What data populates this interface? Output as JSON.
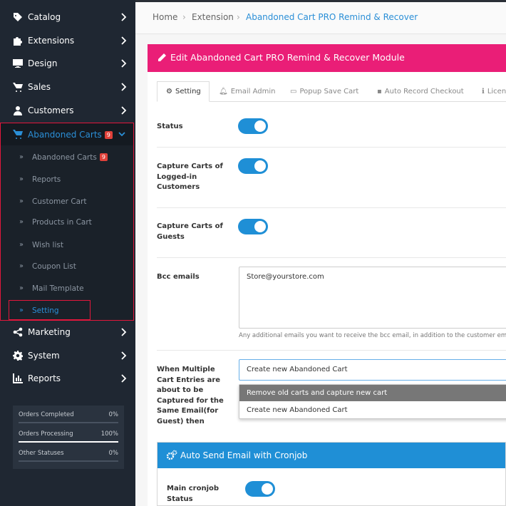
{
  "sidebar": {
    "items": [
      {
        "label": "Catalog",
        "icon": "tag-icon"
      },
      {
        "label": "Extensions",
        "icon": "puzzle-icon"
      },
      {
        "label": "Design",
        "icon": "monitor-icon"
      },
      {
        "label": "Sales",
        "icon": "cart-icon"
      },
      {
        "label": "Customers",
        "icon": "user-icon"
      }
    ],
    "abandoned": {
      "label": "Abandoned Carts",
      "badge": "9",
      "subitems": [
        {
          "label": "Abandoned Carts",
          "badge": "9"
        },
        {
          "label": "Reports"
        },
        {
          "label": "Customer Cart"
        },
        {
          "label": "Products in Cart"
        },
        {
          "label": "Wish list"
        },
        {
          "label": "Coupon List"
        },
        {
          "label": "Mail Template"
        },
        {
          "label": "Setting"
        }
      ]
    },
    "items_after": [
      {
        "label": "Marketing",
        "icon": "share-icon"
      },
      {
        "label": "System",
        "icon": "cog-icon"
      },
      {
        "label": "Reports",
        "icon": "bar-chart-icon"
      }
    ],
    "stats": [
      {
        "label": "Orders Completed",
        "value": "0%",
        "fraction": 0
      },
      {
        "label": "Orders Processing",
        "value": "100%",
        "fraction": 1
      },
      {
        "label": "Other Statuses",
        "value": "0%",
        "fraction": 0
      }
    ]
  },
  "breadcrumb": [
    "Home",
    "Extension",
    "Abandoned Cart PRO Remind & Recover"
  ],
  "panel": {
    "title": "Edit Abandoned Cart PRO Remind & Recover Module",
    "tabs": [
      {
        "label": "Setting",
        "icon": "cog-icon"
      },
      {
        "label": "Email Admin",
        "icon": "bell-icon"
      },
      {
        "label": "Popup Save Cart",
        "icon": "monitor-icon"
      },
      {
        "label": "Auto Record Checkout",
        "icon": "save-icon"
      },
      {
        "label": "Licen",
        "icon": "info-icon"
      }
    ]
  },
  "form": {
    "status_label": "Status",
    "logged_label": "Capture Carts of Logged-in Customers",
    "guests_label": "Capture Carts of Guests",
    "bcc_label": "Bcc emails",
    "bcc_value": "Store@yourstore.com",
    "bcc_help": "Any additional emails you want to receive the bcc email, in addition to the customer ema",
    "multi_label": "When Multiple Cart Entries are about to be Captured for the Same Email(for Guest) then",
    "multi_selected": "Create new Abandoned Cart",
    "multi_options": [
      "Remove old carts and capture new cart",
      "Create new Abandoned Cart"
    ],
    "toggles": {
      "status": true,
      "logged": true,
      "guests": true,
      "cron": true
    }
  },
  "cron": {
    "title": "Auto Send Email with Cronjob",
    "main_label": "Main cronjob Status"
  },
  "colors": {
    "accent": "#1f8fd6",
    "header": "#ea1e77",
    "highlight_border": "#e2173c",
    "sidebar": "#1f2732"
  }
}
